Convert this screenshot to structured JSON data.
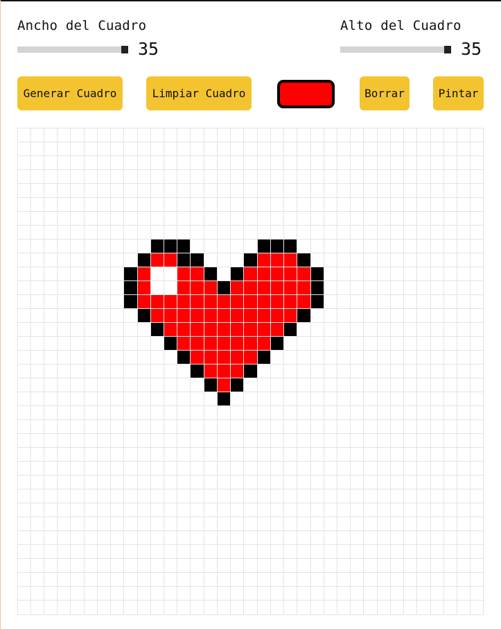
{
  "controls": {
    "width_label": "Ancho del Cuadro",
    "width_value": 35,
    "height_label": "Alto del Cuadro",
    "height_value": 35,
    "generate_label": "Generar Cuadro",
    "clear_label": "Limpiar Cuadro",
    "erase_label": "Borrar",
    "paint_label": "Pintar",
    "selected_color": "#ff0000"
  },
  "canvas": {
    "colors": {
      "k": "#000000",
      "r": "#ff0000"
    },
    "pixels": [
      {
        "row": 8,
        "cells": {
          "10": "k",
          "11": "k",
          "12": "k",
          "18": "k",
          "19": "k",
          "20": "k"
        }
      },
      {
        "row": 9,
        "cells": {
          "9": "k",
          "10": "r",
          "11": "r",
          "12": "k",
          "13": "k",
          "17": "k",
          "18": "r",
          "19": "r",
          "20": "r",
          "21": "k"
        }
      },
      {
        "row": 10,
        "cells": {
          "8": "k",
          "9": "r",
          "12": "r",
          "13": "r",
          "14": "k",
          "16": "k",
          "17": "r",
          "18": "r",
          "19": "r",
          "20": "r",
          "21": "r",
          "22": "k"
        }
      },
      {
        "row": 11,
        "cells": {
          "8": "k",
          "9": "r",
          "12": "r",
          "13": "r",
          "14": "r",
          "15": "k",
          "16": "r",
          "17": "r",
          "18": "r",
          "19": "r",
          "20": "r",
          "21": "r",
          "22": "k"
        }
      },
      {
        "row": 12,
        "cells": {
          "8": "k",
          "9": "r",
          "10": "r",
          "11": "r",
          "12": "r",
          "13": "r",
          "14": "r",
          "15": "r",
          "16": "r",
          "17": "r",
          "18": "r",
          "19": "r",
          "20": "r",
          "21": "r",
          "22": "k"
        }
      },
      {
        "row": 13,
        "cells": {
          "9": "k",
          "10": "r",
          "11": "r",
          "12": "r",
          "13": "r",
          "14": "r",
          "15": "r",
          "16": "r",
          "17": "r",
          "18": "r",
          "19": "r",
          "20": "r",
          "21": "k"
        }
      },
      {
        "row": 14,
        "cells": {
          "10": "k",
          "11": "r",
          "12": "r",
          "13": "r",
          "14": "r",
          "15": "r",
          "16": "r",
          "17": "r",
          "18": "r",
          "19": "r",
          "20": "k"
        }
      },
      {
        "row": 15,
        "cells": {
          "11": "k",
          "12": "r",
          "13": "r",
          "14": "r",
          "15": "r",
          "16": "r",
          "17": "r",
          "18": "r",
          "19": "k"
        }
      },
      {
        "row": 16,
        "cells": {
          "12": "k",
          "13": "r",
          "14": "r",
          "15": "r",
          "16": "r",
          "17": "r",
          "18": "k"
        }
      },
      {
        "row": 17,
        "cells": {
          "13": "k",
          "14": "r",
          "15": "r",
          "16": "r",
          "17": "k"
        }
      },
      {
        "row": 18,
        "cells": {
          "14": "k",
          "15": "r",
          "16": "k"
        }
      },
      {
        "row": 19,
        "cells": {
          "15": "k"
        }
      }
    ]
  }
}
